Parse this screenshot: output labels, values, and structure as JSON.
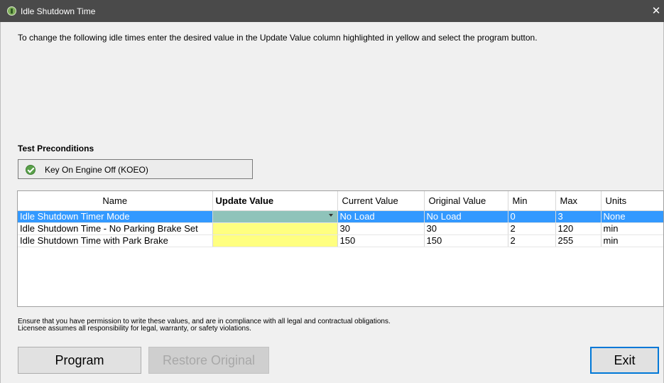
{
  "window": {
    "title": "Idle Shutdown Time",
    "close_symbol": "✕"
  },
  "instructions": "To change the following idle times enter the desired value in the Update Value column highlighted in yellow and select the program button.",
  "preconditions": {
    "heading": "Test Preconditions",
    "items": [
      {
        "label": "Key On Engine Off (KOEO)",
        "status_icon": "check-circle-icon"
      }
    ]
  },
  "table": {
    "columns": [
      "Name",
      "Update Value",
      "Current Value",
      "Original Value",
      "Min",
      "Max",
      "Units"
    ],
    "rows": [
      {
        "name": "Idle Shutdown Timer Mode",
        "update_value": "",
        "current": "No Load",
        "original": "No Load",
        "min": "0",
        "max": "3",
        "units": "None",
        "selected": true
      },
      {
        "name": "Idle Shutdown Time - No Parking Brake Set",
        "update_value": "",
        "current": "30",
        "original": "30",
        "min": "2",
        "max": "120",
        "units": "min",
        "selected": false
      },
      {
        "name": "Idle Shutdown Time with Park Brake",
        "update_value": "",
        "current": "150",
        "original": "150",
        "min": "2",
        "max": "255",
        "units": "min",
        "selected": false
      }
    ]
  },
  "disclaimer": {
    "line1": "Ensure that you have permission to write these values, and are in compliance with all legal and contractual obligations.",
    "line2": "Licensee assumes all responsibility for legal, warranty, or safety violations."
  },
  "buttons": {
    "program": "Program",
    "restore": "Restore Original",
    "exit": "Exit"
  },
  "colors": {
    "titlebar": "#4a4a4a",
    "selection": "#3399ff",
    "editable_cell": "#ffff80",
    "selected_editable_cell": "#8fc3ba",
    "focus_border": "#0078d7"
  }
}
